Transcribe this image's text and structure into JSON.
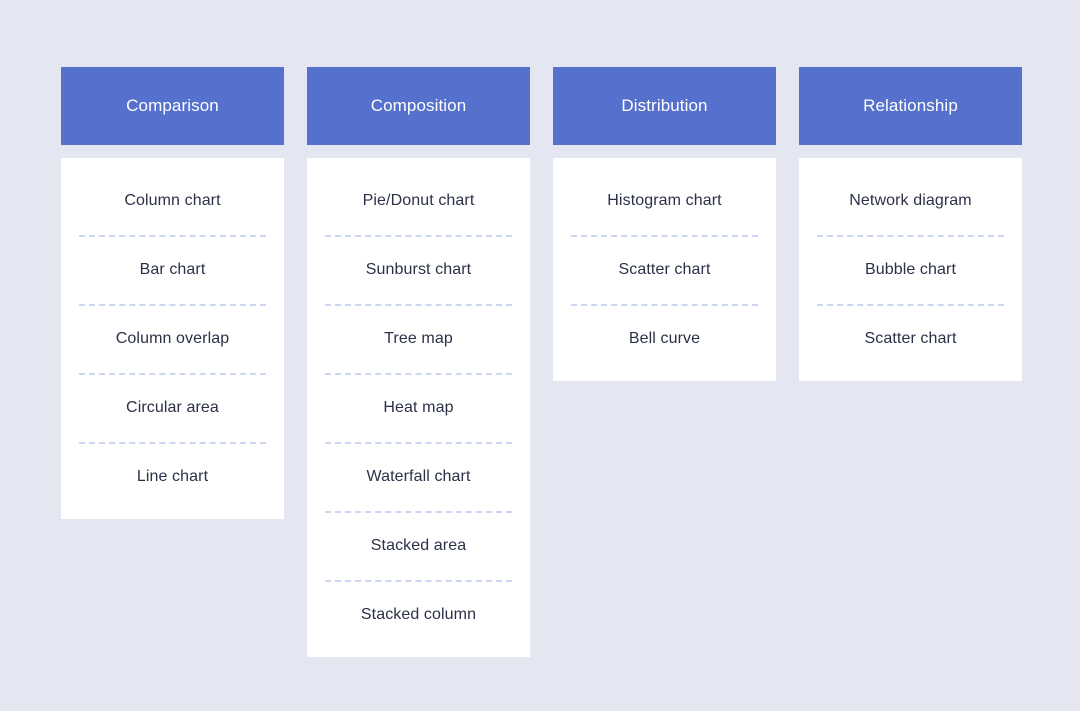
{
  "theme": {
    "page_background": "#e4e7f1",
    "header_background": "#5570cd",
    "header_text_color": "#ffffff",
    "card_background": "#ffffff",
    "item_text_color": "#2b3147",
    "divider_color": "#ccd6f0"
  },
  "columns": [
    {
      "title": "Comparison",
      "items": [
        {
          "label": "Column chart"
        },
        {
          "label": "Bar chart"
        },
        {
          "label": "Column overlap"
        },
        {
          "label": "Circular area"
        },
        {
          "label": "Line chart"
        }
      ]
    },
    {
      "title": "Composition",
      "items": [
        {
          "label": "Pie/Donut chart"
        },
        {
          "label": "Sunburst chart"
        },
        {
          "label": "Tree map"
        },
        {
          "label": "Heat map"
        },
        {
          "label": "Waterfall chart"
        },
        {
          "label": "Stacked area"
        },
        {
          "label": "Stacked column"
        }
      ]
    },
    {
      "title": "Distribution",
      "items": [
        {
          "label": "Histogram chart"
        },
        {
          "label": "Scatter chart"
        },
        {
          "label": "Bell curve"
        }
      ]
    },
    {
      "title": "Relationship",
      "items": [
        {
          "label": "Network diagram"
        },
        {
          "label": "Bubble chart"
        },
        {
          "label": "Scatter chart"
        }
      ]
    }
  ]
}
